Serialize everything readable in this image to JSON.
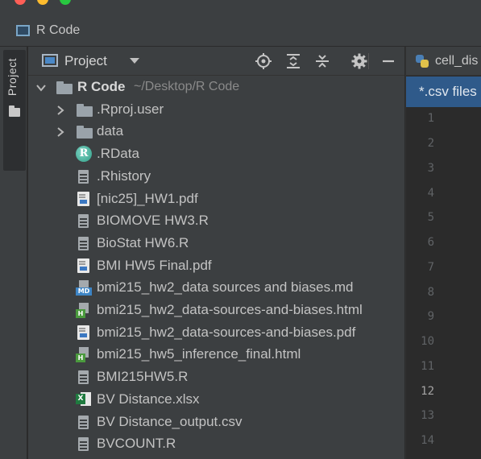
{
  "window": {
    "title": "R Code"
  },
  "tool_window": {
    "strip_label": "Project",
    "header_title": "Project"
  },
  "tree": {
    "root": {
      "name": "R Code",
      "path": "~/Desktop/R Code"
    },
    "items": [
      {
        "name": ".Rproj.user",
        "kind": "folder"
      },
      {
        "name": "data",
        "kind": "folder"
      },
      {
        "name": ".RData",
        "kind": "rdata"
      },
      {
        "name": ".Rhistory",
        "kind": "generic"
      },
      {
        "name": "[nic25]_HW1.pdf",
        "kind": "pdf"
      },
      {
        "name": "BIOMOVE HW3.R",
        "kind": "generic"
      },
      {
        "name": "BioStat HW6.R",
        "kind": "generic"
      },
      {
        "name": "BMI HW5 Final.pdf",
        "kind": "pdf"
      },
      {
        "name": "bmi215_hw2_data sources and biases.md",
        "kind": "md"
      },
      {
        "name": "bmi215_hw2_data-sources-and-biases.html",
        "kind": "html"
      },
      {
        "name": "bmi215_hw2_data-sources-and-biases.pdf",
        "kind": "pdf"
      },
      {
        "name": "bmi215_hw5_inference_final.html",
        "kind": "html"
      },
      {
        "name": "BMI215HW5.R",
        "kind": "generic"
      },
      {
        "name": "BV Distance.xlsx",
        "kind": "xlsx"
      },
      {
        "name": "BV Distance_output.csv",
        "kind": "generic"
      },
      {
        "name": "BVCOUNT.R",
        "kind": "generic"
      }
    ]
  },
  "icons": {
    "rdata_glyph": "R",
    "md_badge": "MD",
    "html_badge": "H",
    "xlsx_badge": "X"
  },
  "editor": {
    "tab_name": "cell_dis",
    "notice": "*.csv files",
    "line_numbers": [
      "1",
      "2",
      "3",
      "4",
      "5",
      "6",
      "7",
      "8",
      "9",
      "10",
      "11",
      "12",
      "13",
      "14"
    ],
    "current_line": "12"
  }
}
